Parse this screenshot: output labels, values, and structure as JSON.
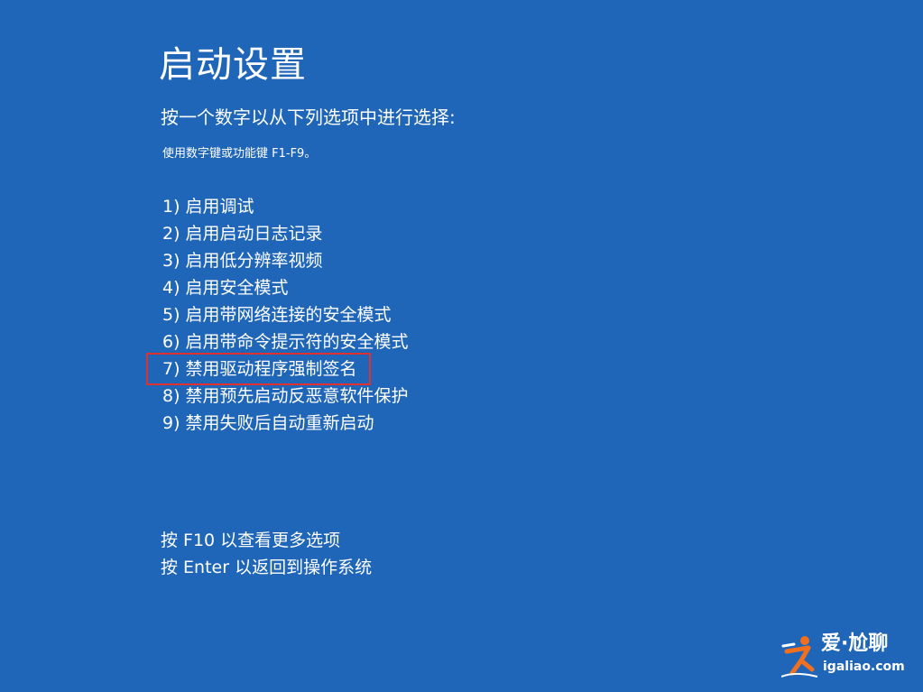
{
  "title": "启动设置",
  "subtitle": "按一个数字以从下列选项中进行选择:",
  "hint": "使用数字键或功能键 F1-F9。",
  "options": [
    "1) 启用调试",
    "2) 启用启动日志记录",
    "3) 启用低分辨率视频",
    "4) 启用安全模式",
    "5) 启用带网络连接的安全模式",
    "6) 启用带命令提示符的安全模式",
    "7) 禁用驱动程序强制签名",
    "8) 禁用预先启动反恶意软件保护",
    "9) 禁用失败后自动重新启动"
  ],
  "footer": {
    "more_options": "按 F10 以查看更多选项",
    "return": "按 Enter 以返回到操作系统"
  },
  "watermark": {
    "brand": "爱·尬聊",
    "url": "igaliao.com"
  },
  "colors": {
    "background": "#1f66b8",
    "text": "#ffffff",
    "highlight": "#e03030",
    "logo_accent": "#f07020"
  }
}
